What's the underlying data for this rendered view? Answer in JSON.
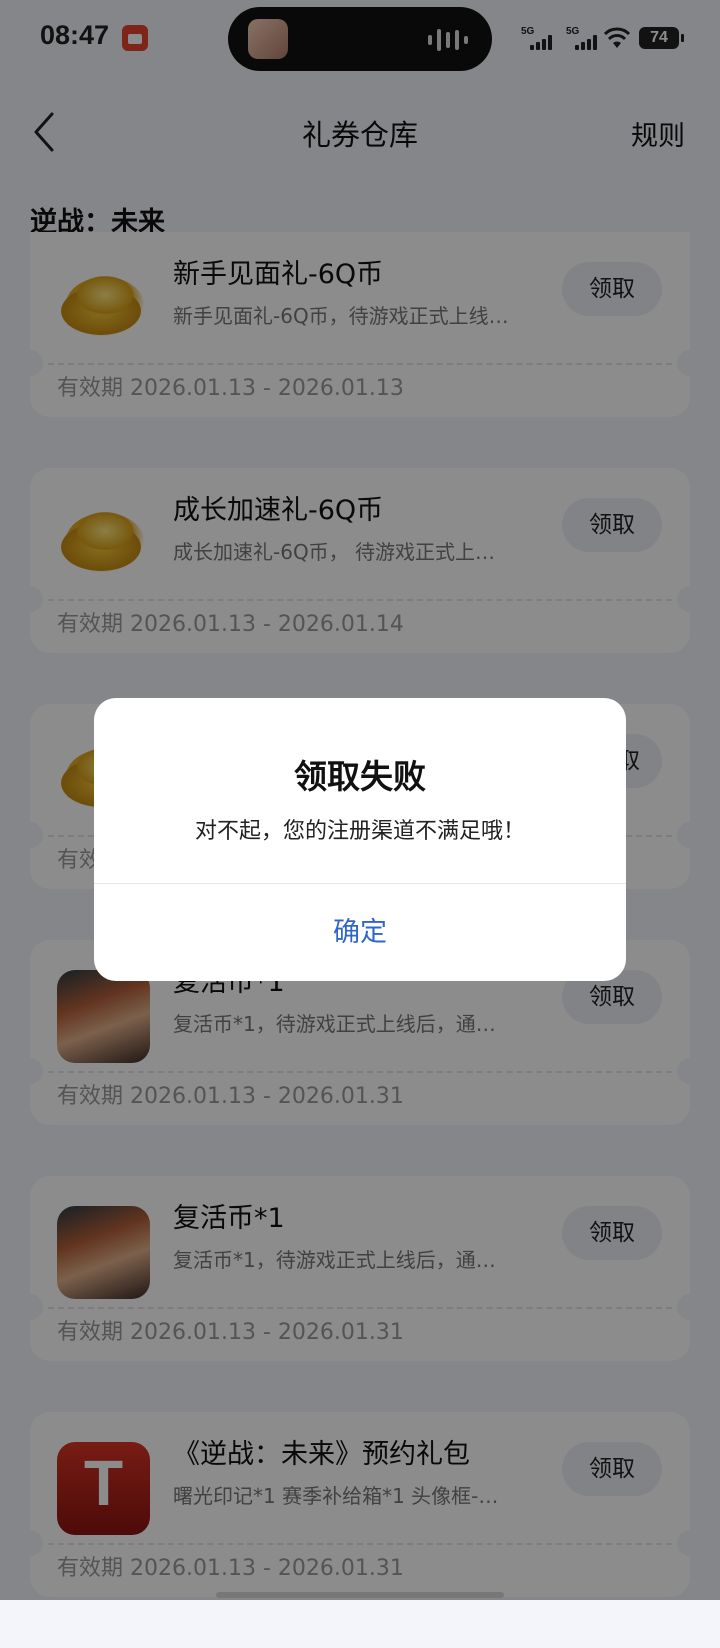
{
  "status_bar": {
    "time": "08:47",
    "signal_1_label": "5G",
    "signal_2_label": "5G",
    "battery": "74"
  },
  "nav": {
    "title": "礼券仓库",
    "rule": "规则"
  },
  "section": {
    "title": "逆战：未来"
  },
  "cards": [
    {
      "title": "新手见面礼-6Q币",
      "desc": "新手见面礼-6Q币，待游戏正式上线…",
      "button": "领取",
      "valid": "有效期 2026.01.13 - 2026.01.13",
      "icon": "coins-icon"
    },
    {
      "title": "成长加速礼-6Q币",
      "desc": "成长加速礼-6Q币， 待游戏正式上…",
      "button": "领取",
      "valid": "有效期 2026.01.13 - 2026.01.14",
      "icon": "coins-icon"
    },
    {
      "title": "",
      "desc": "",
      "button": "取",
      "valid": "有效",
      "icon": "coins-icon"
    },
    {
      "title": "复活币*1",
      "desc": "复活币*1，待游戏正式上线后，通…",
      "button": "领取",
      "valid": "有效期 2026.01.13 - 2026.01.31",
      "icon": "character-portrait-icon"
    },
    {
      "title": "复活币*1",
      "desc": "复活币*1，待游戏正式上线后，通…",
      "button": "领取",
      "valid": "有效期 2026.01.13 - 2026.01.31",
      "icon": "character-portrait-icon"
    },
    {
      "title": "《逆战：未来》预约礼包",
      "desc": "曙光印记*1 赛季补给箱*1 头像框-…",
      "button": "领取",
      "valid": "有效期 2026.01.13 - 2026.01.31",
      "icon": "game-logo-icon"
    }
  ],
  "dialog": {
    "title": "领取失败",
    "message": "对不起，您的注册渠道不满足哦！",
    "confirm": "确定"
  },
  "colors": {
    "overlay": "#000000",
    "confirm_text": "#2f67c8",
    "card_bg": "#ffffff",
    "page_bg": "#f3f5fa"
  }
}
